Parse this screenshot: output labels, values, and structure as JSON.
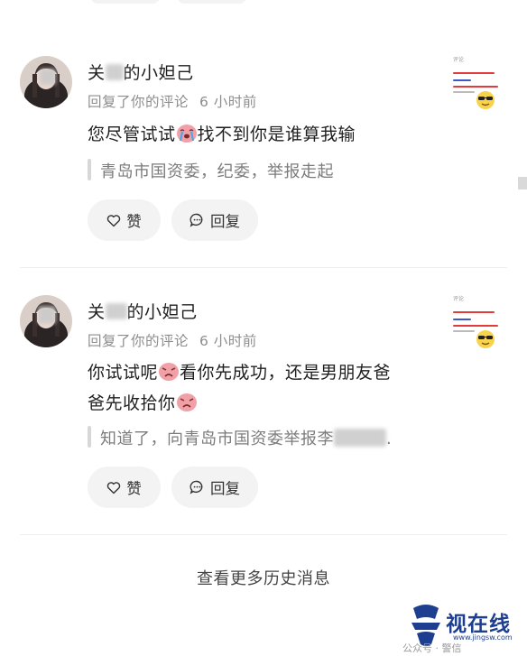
{
  "comments": [
    {
      "user_name": "关注的小妲己",
      "name_prefix": "关",
      "name_suffix": "的小妲己",
      "action": "回复了你的评论",
      "time": "6 小时前",
      "reply_before_emoji": "您尽管试试",
      "reply_after_emoji": "找不到你是谁算我输",
      "reply_emoji": "crying-emoji",
      "quoted": "青岛市国资委，纪委，举报走起",
      "like_label": "赞",
      "reply_label": "回复"
    },
    {
      "user_name": "关注的小妲己",
      "name_prefix": "关",
      "name_suffix": "的小妲己",
      "action": "回复了你的评论",
      "time": "6 小时前",
      "reply_line1_a": "你试试呢",
      "reply_line1_b": "看你先成功，还是男朋友爸",
      "reply_line2_a": "爸先收拾你",
      "reply_emoji": "angry-emoji",
      "quoted_prefix": "知道了，向青岛市国资委举报李",
      "quoted_suffix": ".",
      "like_label": "赞",
      "reply_label": "回复"
    }
  ],
  "thumbnail": {
    "header": "评论",
    "line_colors": [
      "#e23b3b",
      "#3b58c9",
      "#e23b3b",
      "#888888"
    ],
    "emoji": "sunglasses-emoji"
  },
  "history_link": "查看更多历史消息",
  "watermark": {
    "text": "视在线",
    "sub": "www.jingsw.com",
    "account": "公众号 · 警信"
  },
  "colors": {
    "pill_bg": "#f3f3f3",
    "secondary_text": "#8d8d8d",
    "quote_bar": "#d7d7d7",
    "watermark": "#1e3f8f"
  }
}
